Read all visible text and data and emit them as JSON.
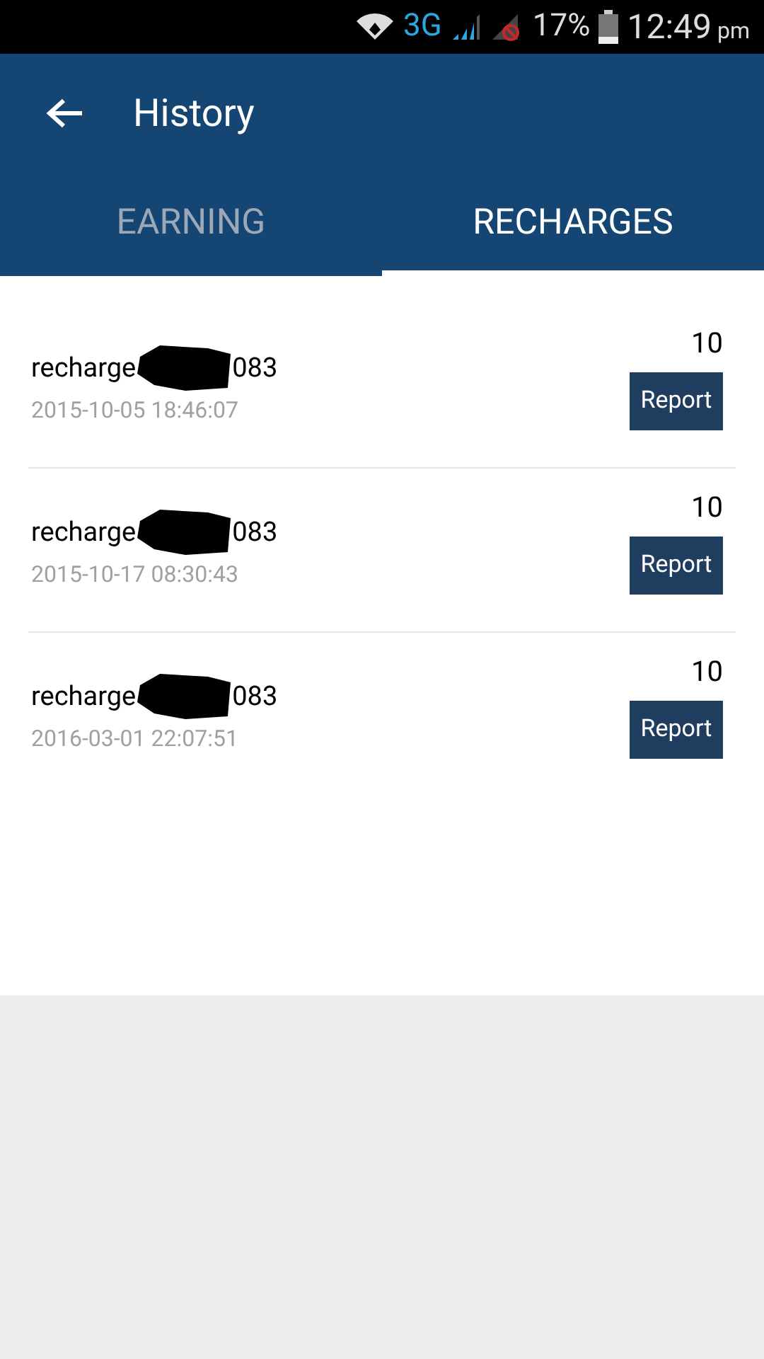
{
  "status_bar": {
    "network": "3G",
    "battery": "17%",
    "time": "12:49",
    "ampm": "pm"
  },
  "header": {
    "title": "History"
  },
  "tabs": [
    {
      "label": "EARNING",
      "selected": false
    },
    {
      "label": "RECHARGES",
      "selected": true
    }
  ],
  "records": [
    {
      "label": "recharge",
      "suffix": "083",
      "date": "2015-10-05 18:46:07",
      "amount": "10",
      "button": "Report"
    },
    {
      "label": "recharge",
      "suffix": "083",
      "date": "2015-10-17 08:30:43",
      "amount": "10",
      "button": "Report"
    },
    {
      "label": "recharge",
      "suffix": "083",
      "date": "2016-03-01 22:07:51",
      "amount": "10",
      "button": "Report"
    }
  ]
}
